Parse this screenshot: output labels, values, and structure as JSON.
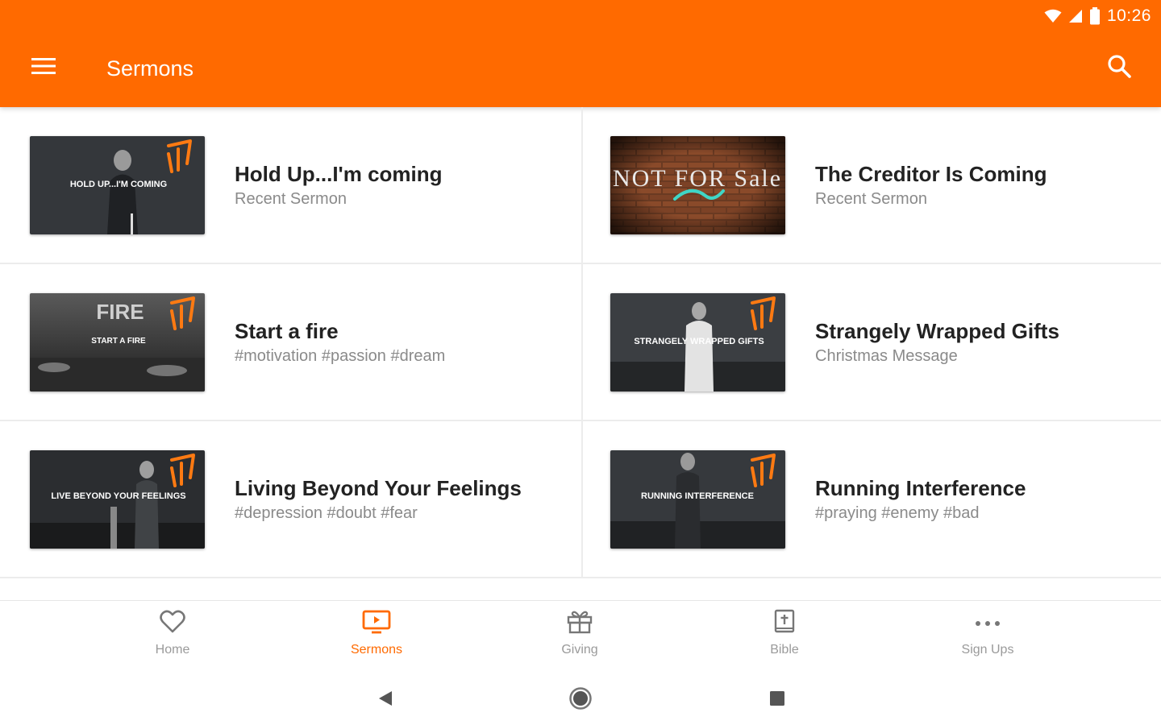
{
  "status_bar": {
    "time": "10:26",
    "icons": [
      "wifi-icon",
      "signal-icon",
      "battery-icon"
    ]
  },
  "app_bar": {
    "title": "Sermons",
    "menu_icon": "hamburger-menu-icon",
    "search_icon": "search-icon",
    "color": "#ff6a00"
  },
  "sermons": [
    {
      "title": "Hold Up...I'm coming",
      "subtitle": "Recent Sermon",
      "thumb_text": "HOLD UP...I'M COMING"
    },
    {
      "title": "The Creditor Is Coming",
      "subtitle": "Recent Sermon",
      "thumb_text": "NOT FOR Sale"
    },
    {
      "title": "Start a fire",
      "subtitle": "#motivation #passion #dream",
      "thumb_text": "FIRE",
      "thumb_sub": "START A FIRE"
    },
    {
      "title": "Strangely Wrapped Gifts",
      "subtitle": "Christmas Message",
      "thumb_text": "STRANGELY WRAPPED GIFTS"
    },
    {
      "title": "Living Beyond Your Feelings",
      "subtitle": "#depression #doubt #fear",
      "thumb_text": "LIVE BEYOND YOUR FEELINGS"
    },
    {
      "title": "Running Interference",
      "subtitle": "#praying #enemy #bad",
      "thumb_text": "RUNNING INTERFERENCE"
    }
  ],
  "bottom_nav": {
    "items": [
      {
        "label": "Home",
        "icon": "heart-icon"
      },
      {
        "label": "Sermons",
        "icon": "tv-play-icon",
        "active": true
      },
      {
        "label": "Giving",
        "icon": "gift-icon"
      },
      {
        "label": "Bible",
        "icon": "bible-icon"
      },
      {
        "label": "Sign Ups",
        "icon": "more-horizontal-icon"
      }
    ]
  },
  "system_nav": [
    "back-icon",
    "home-circle-icon",
    "recents-square-icon"
  ]
}
